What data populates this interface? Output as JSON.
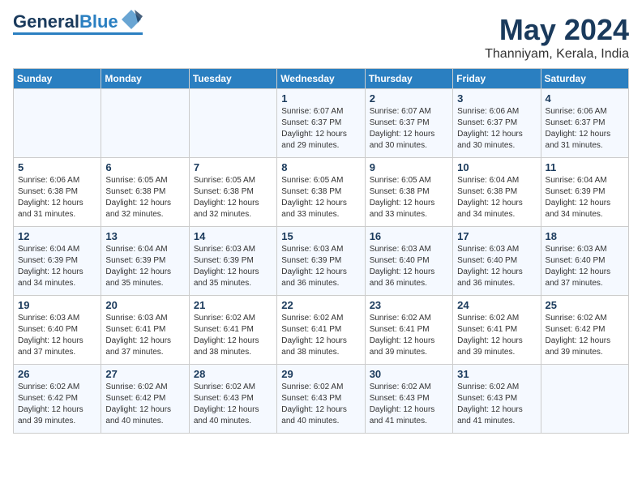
{
  "logo": {
    "text1": "General",
    "text2": "Blue"
  },
  "title": "May 2024",
  "subtitle": "Thanniyam, Kerala, India",
  "weekdays": [
    "Sunday",
    "Monday",
    "Tuesday",
    "Wednesday",
    "Thursday",
    "Friday",
    "Saturday"
  ],
  "weeks": [
    [
      {
        "day": "",
        "info": ""
      },
      {
        "day": "",
        "info": ""
      },
      {
        "day": "",
        "info": ""
      },
      {
        "day": "1",
        "info": "Sunrise: 6:07 AM\nSunset: 6:37 PM\nDaylight: 12 hours\nand 29 minutes."
      },
      {
        "day": "2",
        "info": "Sunrise: 6:07 AM\nSunset: 6:37 PM\nDaylight: 12 hours\nand 30 minutes."
      },
      {
        "day": "3",
        "info": "Sunrise: 6:06 AM\nSunset: 6:37 PM\nDaylight: 12 hours\nand 30 minutes."
      },
      {
        "day": "4",
        "info": "Sunrise: 6:06 AM\nSunset: 6:37 PM\nDaylight: 12 hours\nand 31 minutes."
      }
    ],
    [
      {
        "day": "5",
        "info": "Sunrise: 6:06 AM\nSunset: 6:38 PM\nDaylight: 12 hours\nand 31 minutes."
      },
      {
        "day": "6",
        "info": "Sunrise: 6:05 AM\nSunset: 6:38 PM\nDaylight: 12 hours\nand 32 minutes."
      },
      {
        "day": "7",
        "info": "Sunrise: 6:05 AM\nSunset: 6:38 PM\nDaylight: 12 hours\nand 32 minutes."
      },
      {
        "day": "8",
        "info": "Sunrise: 6:05 AM\nSunset: 6:38 PM\nDaylight: 12 hours\nand 33 minutes."
      },
      {
        "day": "9",
        "info": "Sunrise: 6:05 AM\nSunset: 6:38 PM\nDaylight: 12 hours\nand 33 minutes."
      },
      {
        "day": "10",
        "info": "Sunrise: 6:04 AM\nSunset: 6:38 PM\nDaylight: 12 hours\nand 34 minutes."
      },
      {
        "day": "11",
        "info": "Sunrise: 6:04 AM\nSunset: 6:39 PM\nDaylight: 12 hours\nand 34 minutes."
      }
    ],
    [
      {
        "day": "12",
        "info": "Sunrise: 6:04 AM\nSunset: 6:39 PM\nDaylight: 12 hours\nand 34 minutes."
      },
      {
        "day": "13",
        "info": "Sunrise: 6:04 AM\nSunset: 6:39 PM\nDaylight: 12 hours\nand 35 minutes."
      },
      {
        "day": "14",
        "info": "Sunrise: 6:03 AM\nSunset: 6:39 PM\nDaylight: 12 hours\nand 35 minutes."
      },
      {
        "day": "15",
        "info": "Sunrise: 6:03 AM\nSunset: 6:39 PM\nDaylight: 12 hours\nand 36 minutes."
      },
      {
        "day": "16",
        "info": "Sunrise: 6:03 AM\nSunset: 6:40 PM\nDaylight: 12 hours\nand 36 minutes."
      },
      {
        "day": "17",
        "info": "Sunrise: 6:03 AM\nSunset: 6:40 PM\nDaylight: 12 hours\nand 36 minutes."
      },
      {
        "day": "18",
        "info": "Sunrise: 6:03 AM\nSunset: 6:40 PM\nDaylight: 12 hours\nand 37 minutes."
      }
    ],
    [
      {
        "day": "19",
        "info": "Sunrise: 6:03 AM\nSunset: 6:40 PM\nDaylight: 12 hours\nand 37 minutes."
      },
      {
        "day": "20",
        "info": "Sunrise: 6:03 AM\nSunset: 6:41 PM\nDaylight: 12 hours\nand 37 minutes."
      },
      {
        "day": "21",
        "info": "Sunrise: 6:02 AM\nSunset: 6:41 PM\nDaylight: 12 hours\nand 38 minutes."
      },
      {
        "day": "22",
        "info": "Sunrise: 6:02 AM\nSunset: 6:41 PM\nDaylight: 12 hours\nand 38 minutes."
      },
      {
        "day": "23",
        "info": "Sunrise: 6:02 AM\nSunset: 6:41 PM\nDaylight: 12 hours\nand 39 minutes."
      },
      {
        "day": "24",
        "info": "Sunrise: 6:02 AM\nSunset: 6:41 PM\nDaylight: 12 hours\nand 39 minutes."
      },
      {
        "day": "25",
        "info": "Sunrise: 6:02 AM\nSunset: 6:42 PM\nDaylight: 12 hours\nand 39 minutes."
      }
    ],
    [
      {
        "day": "26",
        "info": "Sunrise: 6:02 AM\nSunset: 6:42 PM\nDaylight: 12 hours\nand 39 minutes."
      },
      {
        "day": "27",
        "info": "Sunrise: 6:02 AM\nSunset: 6:42 PM\nDaylight: 12 hours\nand 40 minutes."
      },
      {
        "day": "28",
        "info": "Sunrise: 6:02 AM\nSunset: 6:43 PM\nDaylight: 12 hours\nand 40 minutes."
      },
      {
        "day": "29",
        "info": "Sunrise: 6:02 AM\nSunset: 6:43 PM\nDaylight: 12 hours\nand 40 minutes."
      },
      {
        "day": "30",
        "info": "Sunrise: 6:02 AM\nSunset: 6:43 PM\nDaylight: 12 hours\nand 41 minutes."
      },
      {
        "day": "31",
        "info": "Sunrise: 6:02 AM\nSunset: 6:43 PM\nDaylight: 12 hours\nand 41 minutes."
      },
      {
        "day": "",
        "info": ""
      }
    ]
  ]
}
